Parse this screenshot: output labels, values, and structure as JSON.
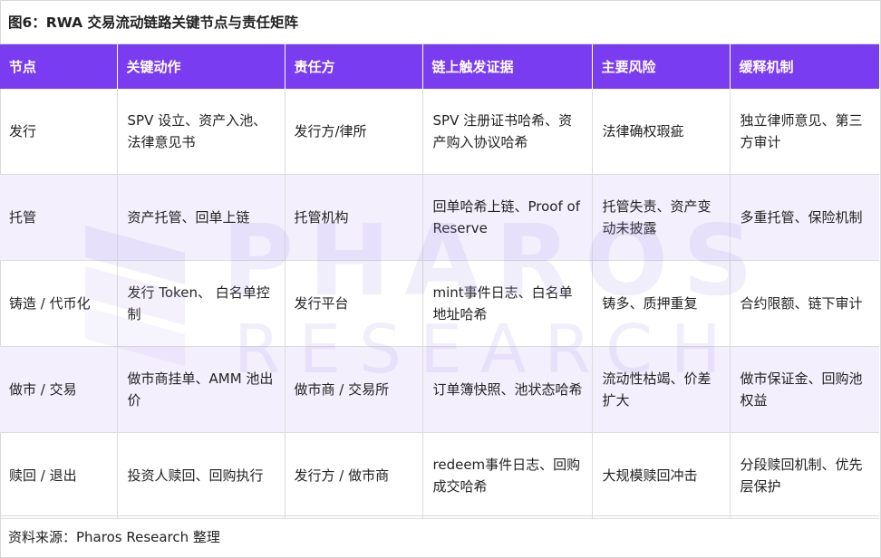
{
  "figure": {
    "title": "图6：RWA 交易流动链路关键节点与责任矩阵",
    "source": "资料来源：Pharos Research 整理"
  },
  "watermark": {
    "line1": "PHAROS",
    "line2": "RESEARCH",
    "logo_icon": "pharos-logo-icon",
    "color": "#aa96eb"
  },
  "table": {
    "headers": [
      "节点",
      "关键动作",
      "责任方",
      "链上触发证据",
      "主要风险",
      "缓释机制"
    ],
    "rows": [
      [
        "发行",
        "SPV 设立、资产入池、法律意见书",
        "发行方/律所",
        "SPV 注册证书哈希、资产购入协议哈希",
        "法律确权瑕疵",
        "独立律师意见、第三方审计"
      ],
      [
        "托管",
        "资产托管、回单上链",
        "托管机构",
        "回单哈希上链、Proof of Reserve",
        "托管失责、资产变动未披露",
        "多重托管、保险机制"
      ],
      [
        "铸造 / 代币化",
        "发行 Token、 白名单控制",
        "发行平台",
        "mint事件日志、白名单地址哈希",
        "铸多、质押重复",
        "合约限额、链下审计"
      ],
      [
        "做市 / 交易",
        "做市商挂单、AMM 池出价",
        "做市商 / 交易所",
        "订单簿快照、池状态哈希",
        "流动性枯竭、价差扩大",
        "做市保证金、回购池权益"
      ],
      [
        "赎回 / 退出",
        "投资人赎回、回购执行",
        "发行方 / 做市商",
        "redeem事件日志、回购成交哈希",
        "大规模赎回冲击",
        "分段赎回机制、优先层保护"
      ]
    ]
  },
  "colors": {
    "header_bg": "#7a3cf0",
    "header_text": "#ffffff",
    "alt_row_bg": "#f4effd",
    "border": "#dcdcdc"
  }
}
